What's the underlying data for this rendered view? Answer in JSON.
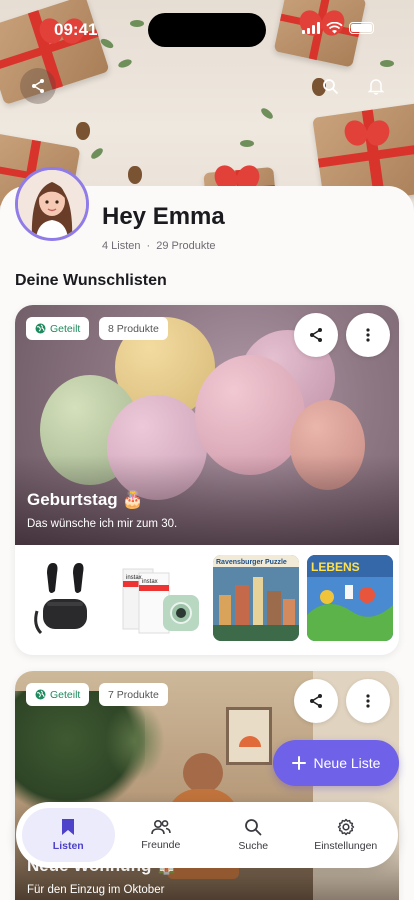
{
  "status": {
    "time": "09:41"
  },
  "profile": {
    "greeting": "Hey Emma",
    "lists_count": "4 Listen",
    "separator": "·",
    "products_count": "29 Produkte"
  },
  "section_title": "Deine Wunschlisten",
  "lists": [
    {
      "shared_label": "Geteilt",
      "count_label": "8 Produkte",
      "title": "Geburtstag 🎂",
      "subtitle": "Das wünsche ich mir zum 30.",
      "thumbnails": [
        "earbuds",
        "instax camera",
        "Ravensburger Puzzle",
        "LEBENS board game"
      ]
    },
    {
      "shared_label": "Geteilt",
      "count_label": "7 Produkte",
      "title": "Neue Wohnung 🏠",
      "subtitle": "Für den Einzug im Oktober"
    }
  ],
  "thumb_text": {
    "instax1": "instax",
    "instax2": "instax",
    "ravensburger": "Ravensburger Puzzle",
    "lebens": "LEBENS"
  },
  "fab": {
    "label": "Neue Liste",
    "icon": "plus-icon"
  },
  "nav": [
    {
      "label": "Listen",
      "icon": "bookmark-icon",
      "active": true
    },
    {
      "label": "Freunde",
      "icon": "people-icon",
      "active": false
    },
    {
      "label": "Suche",
      "icon": "search-icon",
      "active": false
    },
    {
      "label": "Einstellungen",
      "icon": "gear-icon",
      "active": false
    }
  ],
  "colors": {
    "accent": "#6f61e8",
    "shared": "#1f8a5e"
  }
}
